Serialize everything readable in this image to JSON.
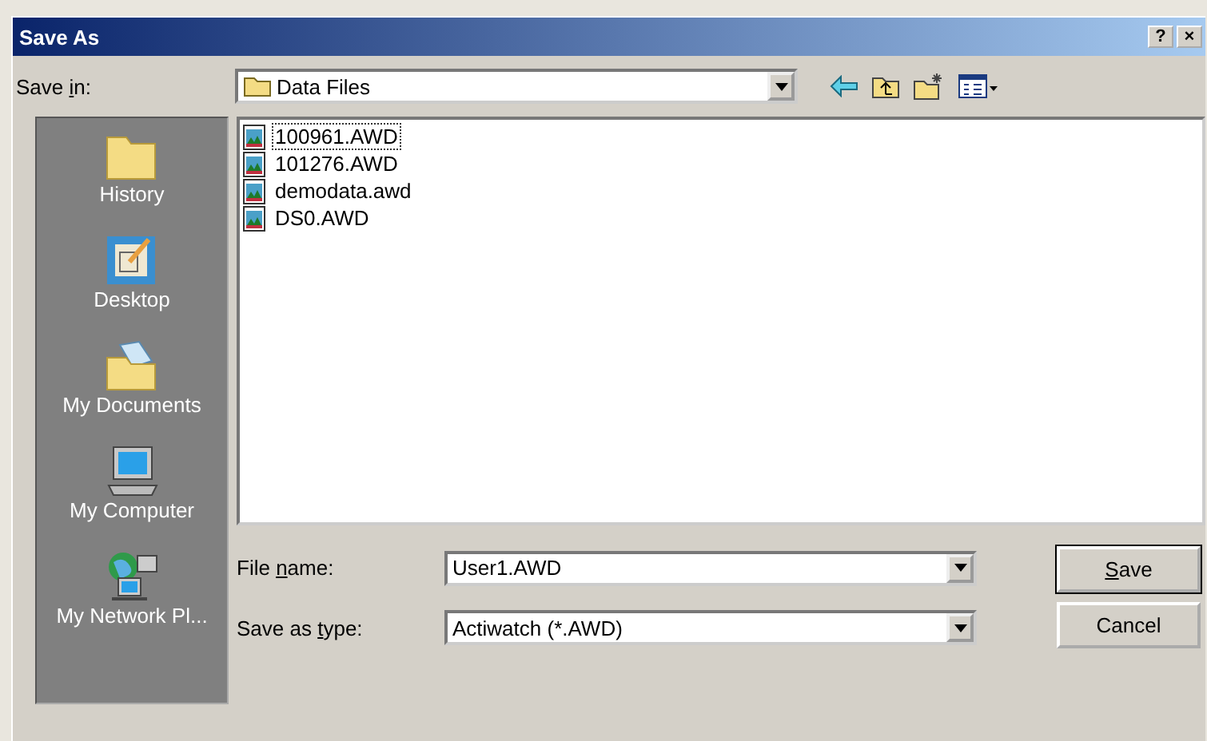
{
  "window": {
    "title": "Save As",
    "title_buttons": [
      "?",
      "×"
    ]
  },
  "save_in": {
    "label_start": "Save ",
    "access_key": "i",
    "label_end": "n:",
    "value": "Data Files"
  },
  "places": [
    {
      "label": "History",
      "kind": "history"
    },
    {
      "label": "Desktop",
      "kind": "desktop"
    },
    {
      "label": "My Documents",
      "kind": "documents"
    },
    {
      "label": "My Computer",
      "kind": "computer"
    },
    {
      "label": "My Network Pl...",
      "kind": "network"
    }
  ],
  "files": [
    {
      "name": "100961.AWD",
      "selected": true
    },
    {
      "name": "101276.AWD",
      "selected": false
    },
    {
      "name": "demodata.awd",
      "selected": false
    },
    {
      "name": "DS0.AWD",
      "selected": false
    }
  ],
  "file_name": {
    "label_start": "File ",
    "access_key": "n",
    "label_end": "ame:",
    "value": "User1.AWD"
  },
  "save_as_type": {
    "label_start": "Save as ",
    "access_key": "t",
    "label_end": "ype:",
    "value": "Actiwatch (*.AWD)"
  },
  "buttons": [
    {
      "access_key": "S",
      "label_end": "ave",
      "kind": "default"
    },
    {
      "label_start": "Cancel",
      "kind": "normal"
    }
  ]
}
